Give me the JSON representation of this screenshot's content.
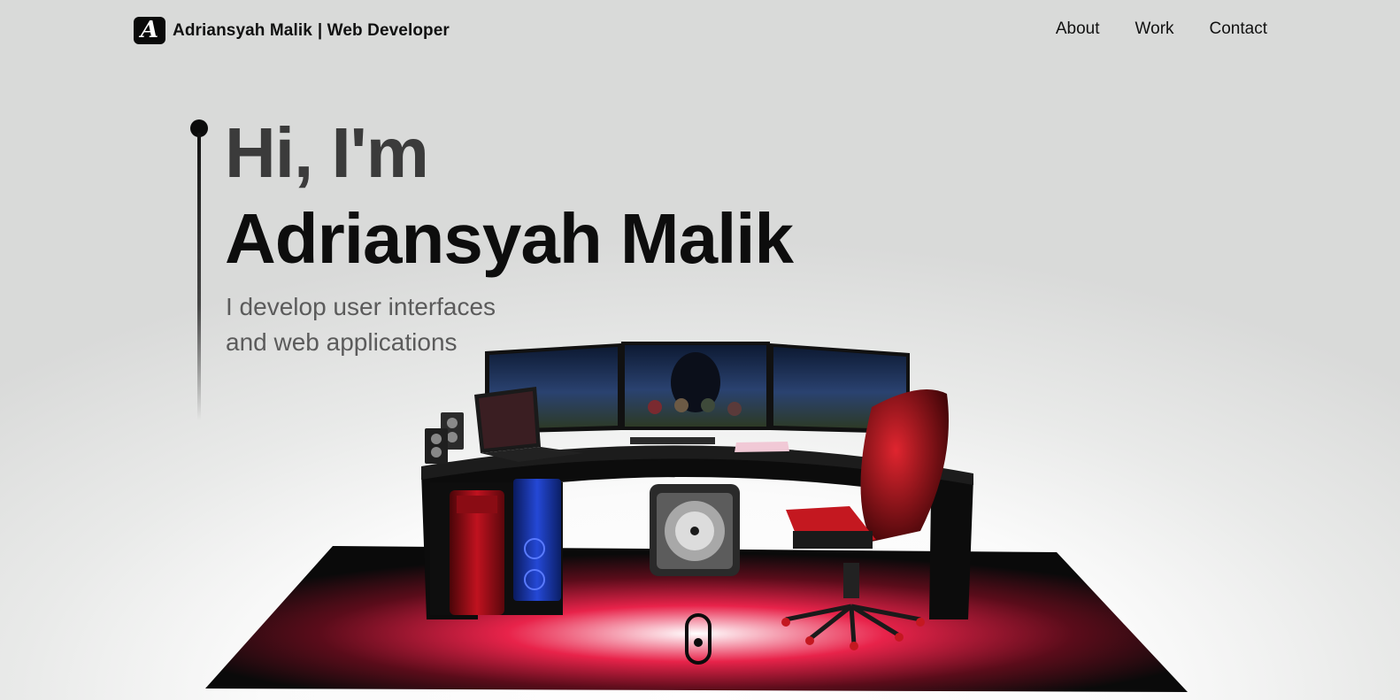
{
  "header": {
    "logo_letter": "A",
    "brand_name": "Adriansyah Malik",
    "brand_role": "| Web Developer",
    "nav": [
      "About",
      "Work",
      "Contact"
    ]
  },
  "hero": {
    "greeting": "Hi, I'm",
    "name": "Adriansyah Malik",
    "tagline_line1": "I develop user interfaces",
    "tagline_line2": "and web applications"
  },
  "colors": {
    "floor_glow": "#e8234a",
    "chair_red": "#b5121b",
    "case_blue": "#1d3fc4",
    "ink": "#0d0d0d"
  },
  "icons": [
    "logo-icon",
    "scroll-mouse-icon"
  ]
}
